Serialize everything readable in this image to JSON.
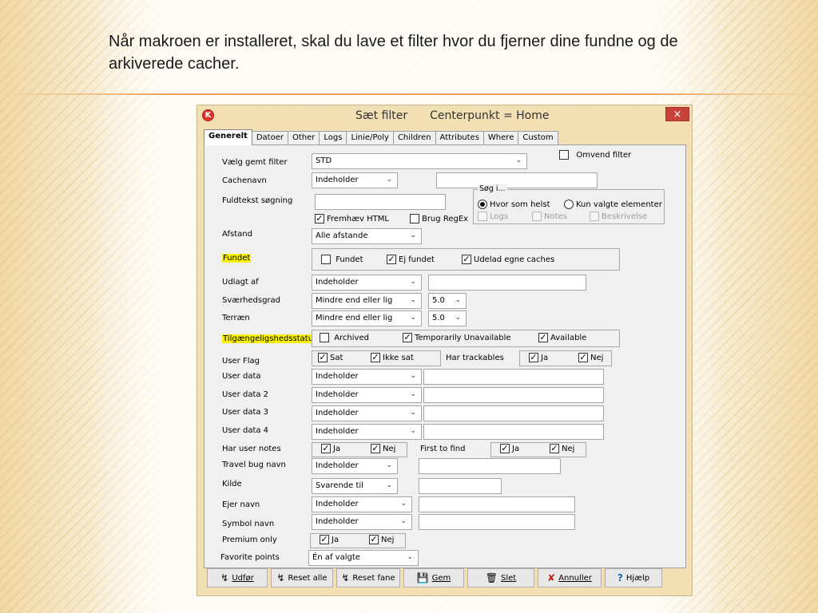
{
  "slide": {
    "heading": "Når makroen er installeret, skal du lave et filter hvor du fjerner dine fundne og de arkiverede cacher."
  },
  "dialog": {
    "app_icon": "K",
    "title": "Sæt filter",
    "subtitle": "Centerpunkt = Home",
    "close": "×",
    "tabs": [
      "Generelt",
      "Datoer",
      "Other",
      "Logs",
      "Linie/Poly",
      "Children",
      "Attributes",
      "Where",
      "Custom"
    ],
    "labels": {
      "saved_filter": "Vælg gemt filter",
      "cachename": "Cachenavn",
      "fulltext": "Fuldtekst søgning",
      "distance": "Afstand",
      "found": "Fundet",
      "placed_by": "Udlagt af",
      "difficulty": "Sværhedsgrad",
      "terrain": "Terræn",
      "availability": "Tilgængeligshedsstatus",
      "user_flag": "User Flag",
      "user_data": "User data",
      "user_data2": "User data 2",
      "user_data3": "User data 3",
      "user_data4": "User data 4",
      "user_notes": "Har user notes",
      "travel_bug": "Travel bug navn",
      "source": "Kilde",
      "owner": "Ejer navn",
      "symbol": "Symbol navn",
      "premium": "Premium only",
      "favorites": "Favorite points",
      "trackables": "Har trackables",
      "first_to_find": "First to find",
      "search_in": "Søg i..."
    },
    "fields": {
      "saved_filter": "STD",
      "cachename_op": "Indeholder",
      "distance": "Alle afstande",
      "placed_by_op": "Indeholder",
      "difficulty_op": "Mindre end eller lig",
      "difficulty_val": "5.0",
      "terrain_op": "Mindre end eller lig",
      "terrain_val": "5.0",
      "user_data_op": "Indeholder",
      "user_data2_op": "Indeholder",
      "user_data3_op": "Indeholder",
      "user_data4_op": "Indeholder",
      "travel_bug_op": "Indeholder",
      "source_op": "Svarende til",
      "owner_op": "Indeholder",
      "symbol_op": "Indeholder",
      "favorites_op": "Én af valgte"
    },
    "checks": {
      "invert": "Omvend filter",
      "highlight_html": "Fremhæv HTML",
      "regex": "Brug RegEx",
      "anywhere": "Hvor som helst",
      "selected_only": "Kun valgte elementer",
      "logs": "Logs",
      "notes": "Notes",
      "description": "Beskrivelse",
      "found": "Fundet",
      "not_found": "Ej fundet",
      "exclude_own": "Udelad egne caches",
      "archived": "Archived",
      "temp_unavailable": "Temporarily Unavailable",
      "available": "Available",
      "set": "Sat",
      "not_set": "Ikke sat",
      "yes": "Ja",
      "no": "Nej"
    },
    "buttons": {
      "execute": "Udfør",
      "reset_all": "Reset alle",
      "reset_tab": "Reset fane",
      "save": "Gem",
      "delete": "Slet",
      "cancel": "Annuller",
      "help": "Hjælp"
    },
    "colors": {
      "highlight": "#f8f200",
      "titlebar": "#f2dfb4",
      "close": "#c7433a"
    }
  }
}
